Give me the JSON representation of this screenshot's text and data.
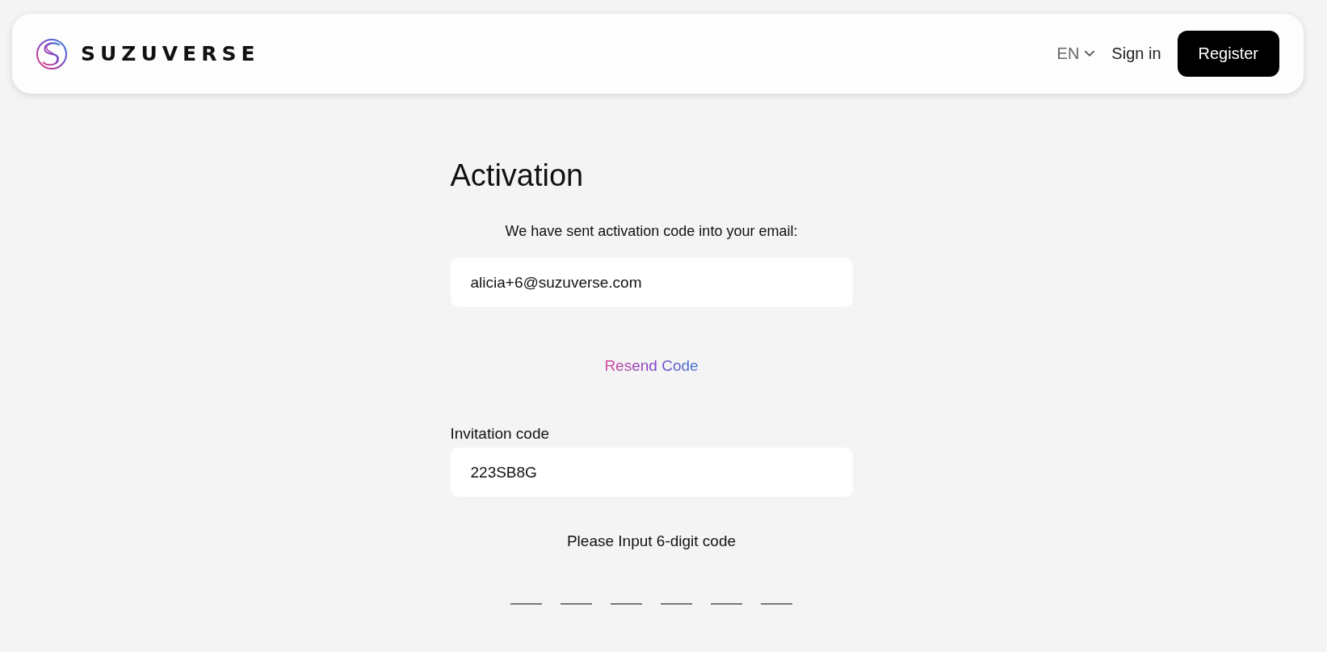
{
  "header": {
    "logo": "SUZUVERSE",
    "language": "EN",
    "sign_in": "Sign in",
    "register": "Register"
  },
  "activation": {
    "title": "Activation",
    "message": "We have sent activation code into your email:",
    "email": "alicia+6@suzuverse.com",
    "resend": "Resend Code",
    "invitation_label": "Invitation code",
    "invitation_value": "223SB8G",
    "code_prompt": "Please Input 6-digit code",
    "code_fields": [
      {
        "kind": "digit"
      },
      {
        "kind": "digit"
      },
      {
        "kind": "digit"
      },
      {
        "kind": "digit"
      },
      {
        "kind": "digit"
      },
      {
        "kind": "digit"
      }
    ]
  }
}
